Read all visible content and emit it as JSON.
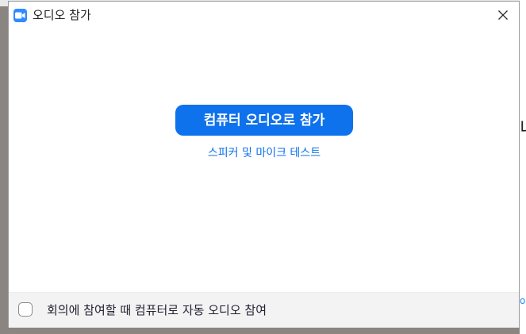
{
  "dialog": {
    "title": "오디오 참가",
    "app_icon": "zoom-video-camera-icon",
    "close_icon": "close-icon"
  },
  "main": {
    "join_button_label": "컴퓨터 오디오로 참가",
    "test_link_label": "스피커 및 마이크 테스트"
  },
  "footer": {
    "auto_join_label": "회의에 참여할 때 컴퓨터로 자동 오디오 참여",
    "auto_join_checked": false
  },
  "colors": {
    "accent": "#0e72ed",
    "app_icon": "#2d8cff",
    "footer_bg": "#f3f3f3"
  }
}
